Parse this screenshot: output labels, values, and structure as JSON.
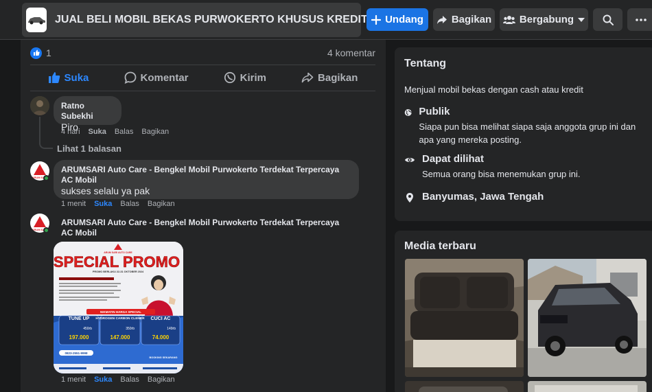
{
  "header": {
    "group_title": "JUAL BELI MOBIL BEKAS PURWOKERTO KHUSUS KREDIT",
    "invite_label": "Undang",
    "share_label": "Bagikan",
    "join_label": "Bergabung",
    "icons": {
      "invite": "plus-icon",
      "share": "share-arrow-icon",
      "join": "people-icon",
      "search": "search-icon",
      "more": "more-dots-icon"
    }
  },
  "post": {
    "reaction_count": "1",
    "comment_count": "4 komentar",
    "actions": {
      "like": "Suka",
      "comment": "Komentar",
      "send": "Kirim",
      "share": "Bagikan"
    }
  },
  "comments": [
    {
      "author": "Ratno Subekhi",
      "text": "Piro",
      "time": "4 hari",
      "like": "Suka",
      "reply": "Balas",
      "share": "Bagikan",
      "replies_link": "Lihat 1 balasan"
    },
    {
      "author": "ARUMSARI Auto Care - Bengkel Mobil Purwokerto Terdekat Terpercaya AC Mobil",
      "text": "sukses selalu ya pak",
      "time": "1 menit",
      "like": "Suka",
      "reply": "Balas",
      "share": "Bagikan"
    },
    {
      "author": "ARUMSARI Auto Care - Bengkel Mobil Purwokerto Terdekat Terpercaya AC Mobil",
      "time": "1 menit",
      "like": "Suka",
      "reply": "Balas",
      "share": "Bagikan",
      "image": {
        "brand": "ARUM SARI AUTO CARE",
        "headline": "SPECIAL PROMO",
        "period": "PROMO BERLAKU 22-31 OKTOBER 2024",
        "section": "NIKMATIN HARGA SPECIAL",
        "items": [
          {
            "name": "TUNE UP",
            "old": "450rb",
            "new": "197.000"
          },
          {
            "name": "HYDROGEN CARBON CLENER",
            "old": "350rb",
            "new": "147.000"
          },
          {
            "name": "CUCI AC",
            "old": "149rb",
            "new": "74.000"
          }
        ],
        "phone": "0823-2551-9998",
        "booking": "BOOKING SEKARANG"
      }
    }
  ],
  "about": {
    "title": "Tentang",
    "description": "Menjual mobil bekas dengan cash atau kredit",
    "privacy_title": "Publik",
    "privacy_desc": "Siapa pun bisa melihat siapa saja anggota grup ini dan apa yang mereka posting.",
    "visible_title": "Dapat dilihat",
    "visible_desc": "Semua orang bisa menemukan grup ini.",
    "location": "Banyumas, Jawa Tengah",
    "icons": {
      "privacy": "globe-icon",
      "visible": "eye-icon",
      "location": "pin-icon"
    }
  },
  "media": {
    "title": "Media terbaru"
  },
  "colors": {
    "accent": "#1b74e4",
    "link_blue": "#2d88ff",
    "online": "#31a24c"
  }
}
